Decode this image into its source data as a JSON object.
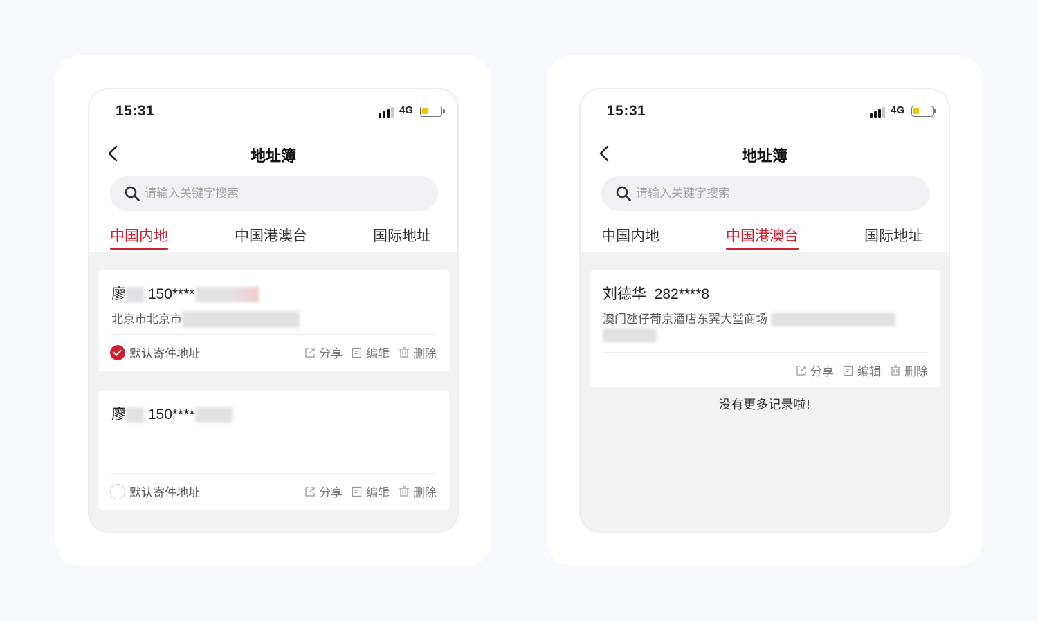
{
  "screens": [
    {
      "status": {
        "time": "15:31",
        "network": "4G"
      },
      "nav": {
        "title": "地址簿"
      },
      "search": {
        "placeholder": "请输入关键字搜索"
      },
      "tabs": [
        {
          "label": "中国内地",
          "active": true
        },
        {
          "label": "中国港澳台",
          "active": false
        },
        {
          "label": "国际地址",
          "active": false
        }
      ],
      "cards": [
        {
          "name": "廖",
          "phone": "150****",
          "address": "北京市北京市",
          "default_label": "默认寄件地址",
          "is_default": true
        },
        {
          "name": "廖",
          "phone": "150****",
          "address": "",
          "default_label": "默认寄件地址",
          "is_default": false
        }
      ],
      "actions": {
        "share": "分享",
        "edit": "编辑",
        "delete": "删除"
      }
    },
    {
      "status": {
        "time": "15:31",
        "network": "4G"
      },
      "nav": {
        "title": "地址簿"
      },
      "search": {
        "placeholder": "请输入关键字搜索"
      },
      "tabs": [
        {
          "label": "中国内地",
          "active": false
        },
        {
          "label": "中国港澳台",
          "active": true
        },
        {
          "label": "国际地址",
          "active": false
        }
      ],
      "cards": [
        {
          "name": "刘德华",
          "phone": "282****8",
          "address": "澳门氹仔葡京酒店东翼大堂商场"
        }
      ],
      "actions": {
        "share": "分享",
        "edit": "编辑",
        "delete": "删除"
      },
      "end_text": "没有更多记录啦!"
    }
  ],
  "colors": {
    "accent": "#d0202f",
    "battery": "#f5c400"
  }
}
